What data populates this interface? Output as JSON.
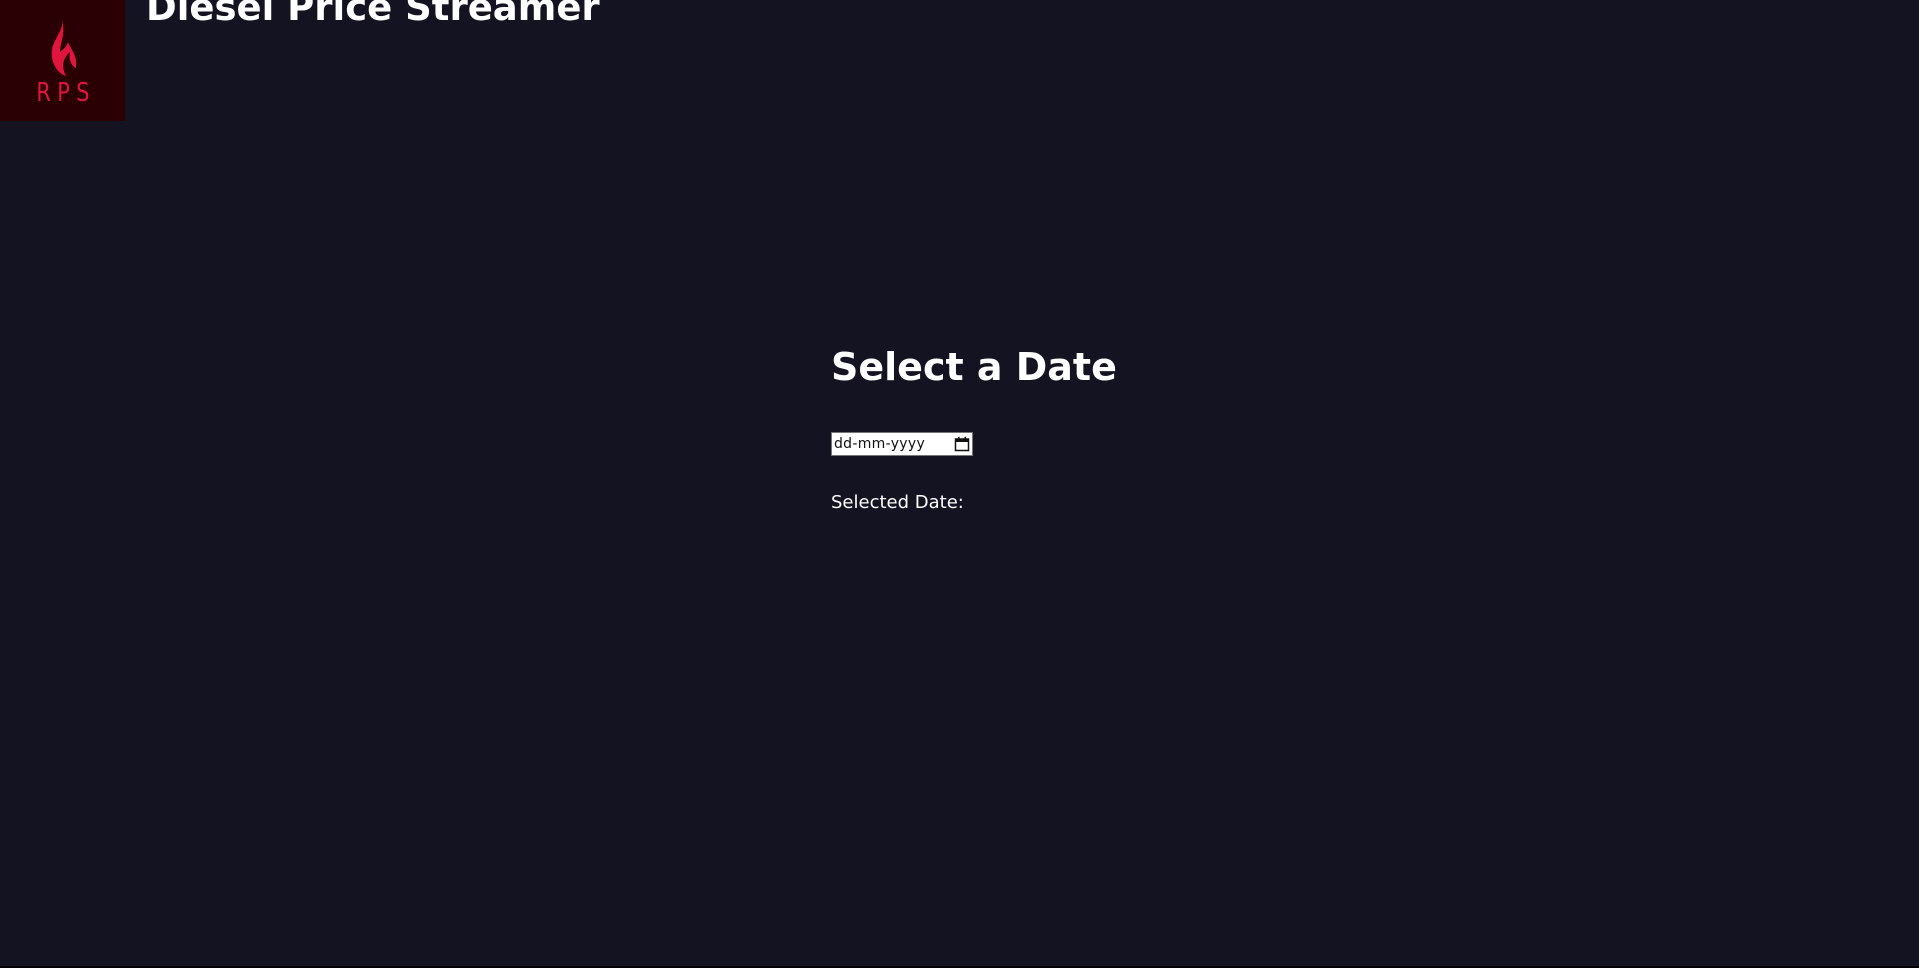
{
  "header": {
    "logo_text": "RPS",
    "logo_icon": "flame-icon",
    "title": "Diesel Price Streamer"
  },
  "main": {
    "heading": "Select a Date",
    "date_input": {
      "placeholder": "dd-mm-yyyy",
      "value": "",
      "icon": "calendar-icon"
    },
    "selected_label": "Selected Date:"
  },
  "colors": {
    "background": "#131322",
    "logo_background": "#2a0005",
    "accent": "#e0143c",
    "text": "#ffffff"
  }
}
